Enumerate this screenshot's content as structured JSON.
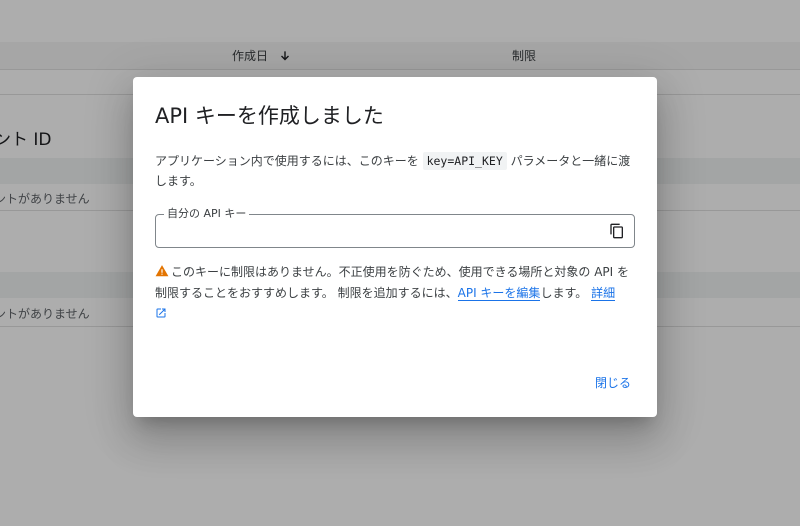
{
  "background": {
    "table_header": {
      "created_col": "作成日",
      "limits_col": "制限"
    },
    "section1_title": "ント ID",
    "section1_empty": "ントがありません",
    "section2_title": "、",
    "section2_empty": "ントがありません"
  },
  "dialog": {
    "title": "API キーを作成しました",
    "description_before": "アプリケーション内で使用するには、このキーを ",
    "description_code": "key=API_KEY",
    "description_after": " パラメータと一緒に渡します。",
    "key_field": {
      "label": "自分の API キー",
      "value": ""
    },
    "warning_text": "このキーに制限はありません。不正使用を防ぐため、使用できる場所と対象の API を制限することをおすすめします。 制限を追加するには、",
    "warning_link": "API キーを編集",
    "warning_after": "します。",
    "details_link": "詳細",
    "close_label": "閉じる"
  },
  "colors": {
    "accent": "#1a73e8",
    "warning": "#e37400"
  },
  "icons": {
    "sort": "arrow-down-icon",
    "copy": "copy-icon",
    "warning": "warning-icon",
    "external": "open-in-new-icon"
  }
}
